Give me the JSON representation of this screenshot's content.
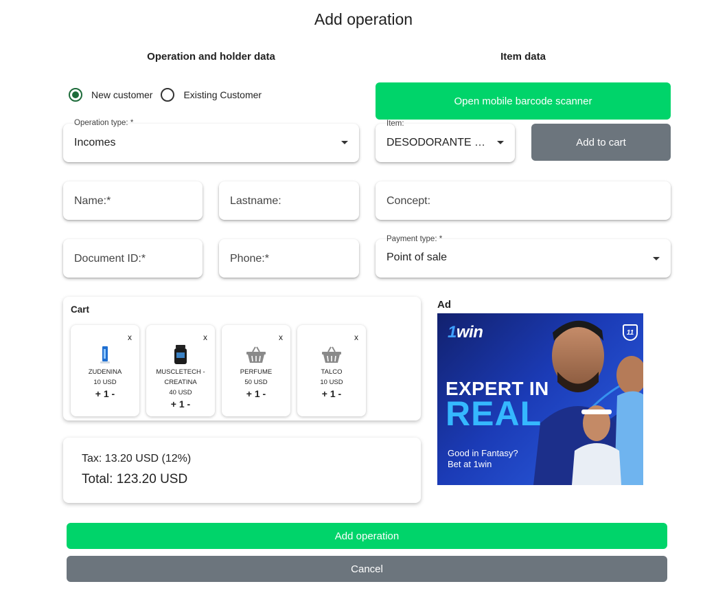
{
  "modal": {
    "title": "Add operation"
  },
  "left_section": {
    "heading": "Operation and holder data"
  },
  "right_section": {
    "heading": "Item data"
  },
  "customer_type": {
    "options": [
      "New customer",
      "Existing Customer"
    ],
    "selected": "New customer"
  },
  "operation_type": {
    "label": "Operation type: *",
    "value": "Incomes"
  },
  "name": {
    "placeholder": "Name:*"
  },
  "lastname": {
    "placeholder": "Lastname:"
  },
  "document_id": {
    "placeholder": "Document ID:*"
  },
  "phone": {
    "placeholder": "Phone:*"
  },
  "scanner_button": {
    "label": "Open mobile barcode scanner"
  },
  "item": {
    "label": "Item:",
    "value": "DESODORANTE RE..."
  },
  "add_to_cart_button": {
    "label": "Add to cart"
  },
  "concept": {
    "placeholder": "Concept:"
  },
  "payment_type": {
    "label": "Payment type: *",
    "value": "Point of sale"
  },
  "cart": {
    "title": "Cart",
    "remove_label": "x",
    "items": [
      {
        "name": "ZUDENINA",
        "price": "10 USD",
        "qty": "+ 1 -",
        "icon": "product-tube-icon"
      },
      {
        "name": "MUSCLETECH - CREATINA",
        "price": "40 USD",
        "qty": "+ 1 -",
        "icon": "product-jar-icon"
      },
      {
        "name": "PERFUME",
        "price": "50 USD",
        "qty": "+ 1 -",
        "icon": "basket-icon"
      },
      {
        "name": "TALCO",
        "price": "10 USD",
        "qty": "+ 1 -",
        "icon": "basket-icon"
      }
    ]
  },
  "totals": {
    "tax": "Tax: 13.20 USD (12%)",
    "total": "Total: 123.20 USD"
  },
  "ad": {
    "label": "Ad",
    "brand": "1win",
    "badge": "11",
    "headline_1": "EXPERT IN",
    "headline_2": "REAL",
    "tagline_1": "Good in Fantasy?",
    "tagline_2": "Bet at 1win"
  },
  "actions": {
    "submit_label": "Add operation",
    "cancel_label": "Cancel"
  },
  "colors": {
    "primary_green": "#00d46a",
    "secondary_gray": "#6c757d",
    "radio_selected": "#1d6b3a"
  }
}
